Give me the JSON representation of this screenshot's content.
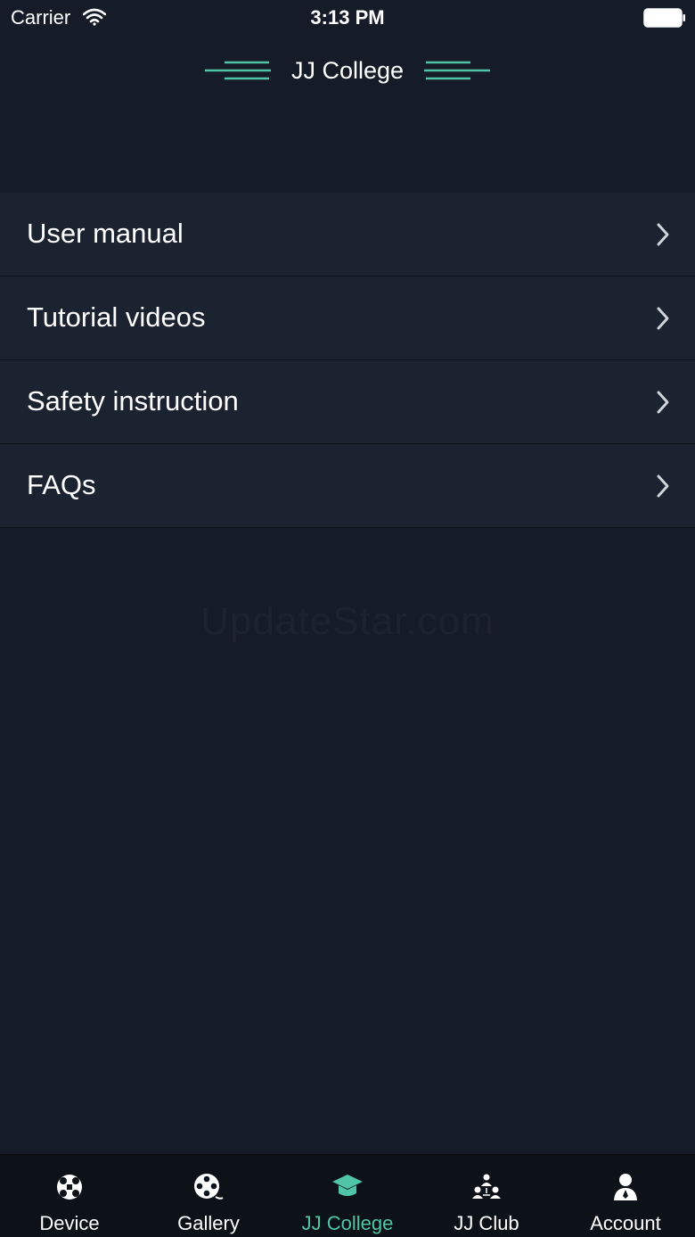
{
  "status_bar": {
    "carrier": "Carrier",
    "time": "3:13 PM"
  },
  "nav": {
    "title": "JJ College",
    "accent_color": "#4fc4a6"
  },
  "menu": {
    "items": [
      {
        "label": "User manual",
        "icon": "chevron-right-icon"
      },
      {
        "label": "Tutorial videos",
        "icon": "chevron-right-icon"
      },
      {
        "label": "Safety instruction",
        "icon": "chevron-right-icon"
      },
      {
        "label": "FAQs",
        "icon": "chevron-right-icon"
      }
    ]
  },
  "watermark": "UpdateStar.com",
  "tabs": [
    {
      "label": "Device",
      "icon": "drone-icon",
      "active": false
    },
    {
      "label": "Gallery",
      "icon": "film-reel-icon",
      "active": false
    },
    {
      "label": "JJ College",
      "icon": "graduation-cap-icon",
      "active": true
    },
    {
      "label": "JJ Club",
      "icon": "group-icon",
      "active": false
    },
    {
      "label": "Account",
      "icon": "user-icon",
      "active": false
    }
  ]
}
